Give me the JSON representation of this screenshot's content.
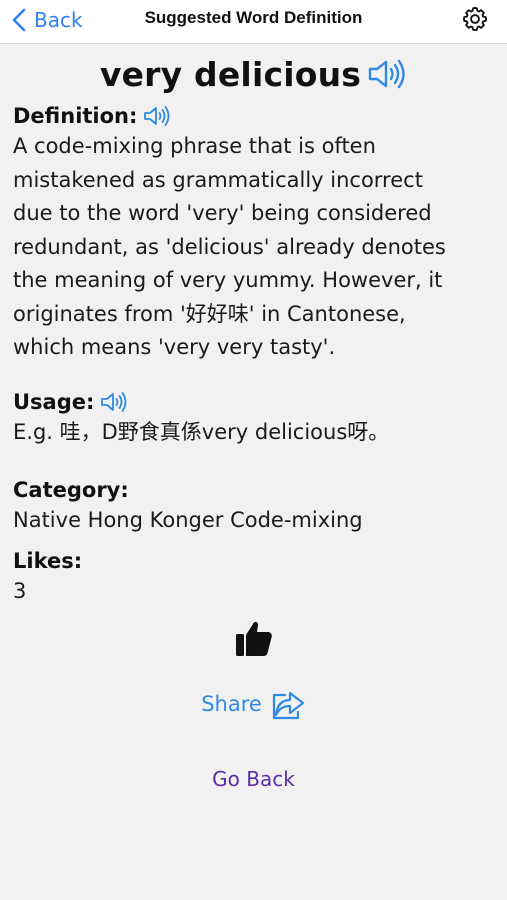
{
  "navbar": {
    "back_label": "Back",
    "title": "Suggested Word Definition",
    "settings_icon": "gear-icon"
  },
  "word": {
    "title": "very delicious",
    "speaker_icon": "speaker-icon"
  },
  "definition": {
    "label": "Definition:",
    "lines": [
      "A code-mixing phrase that is often",
      "mistakened as grammatically incorrect",
      "due to the word 'very' being considered",
      "redundant, as 'delicious' already denotes",
      "the meaning of very yummy.  However, it",
      "originates from '好好味' in Cantonese,",
      "which means 'very very tasty'."
    ]
  },
  "usage": {
    "label": "Usage:",
    "text": "E.g.  哇，D野食真係very delicious呀。"
  },
  "category": {
    "label": "Category:",
    "value": "Native Hong Konger Code-mixing"
  },
  "likes": {
    "label": "Likes:",
    "value": "3",
    "like_icon": "thumbs-up-icon"
  },
  "share": {
    "label": "Share",
    "icon": "share-icon"
  },
  "go_back": {
    "label": "Go Back"
  },
  "colors": {
    "accent_blue": "#2f7ff6",
    "share_blue": "#2f8ae4",
    "go_back_purple": "#5a2ea6",
    "background": "#f1f1f1"
  }
}
